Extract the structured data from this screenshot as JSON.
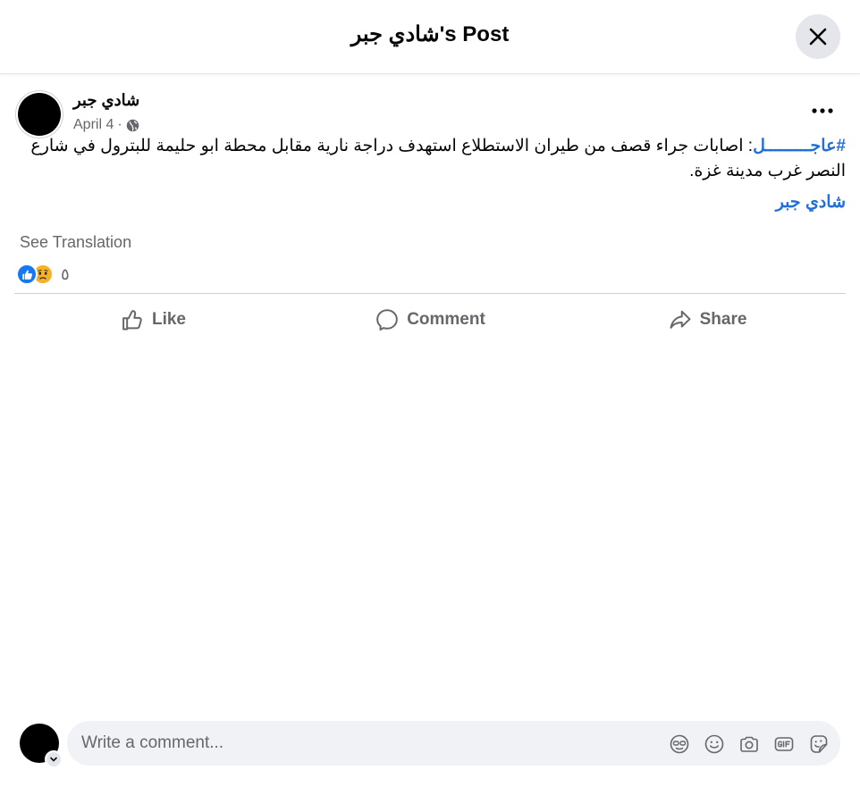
{
  "header": {
    "title": "شادي جبر's Post"
  },
  "post": {
    "author": "شادي جبر",
    "date": "April 4",
    "separator": "·",
    "hashtag": "#عاجـــــــــل",
    "text": ": اصابات جراء قصف من طيران الاستطلاع استهدف دراجة نارية مقابل محطة ابو حليمة للبترول في شارع النصر غرب مدينة غزة.",
    "signature": "شادي جبر",
    "see_translation": "See Translation",
    "reaction_count": "٥"
  },
  "actions": {
    "like": "Like",
    "comment": "Comment",
    "share": "Share"
  },
  "comment_box": {
    "placeholder": "Write a comment..."
  },
  "colors": {
    "accent": "#216fdb",
    "like_blue": "#1877f2",
    "sad_yellow": "#f7b125",
    "secondary_text": "#65676b"
  }
}
